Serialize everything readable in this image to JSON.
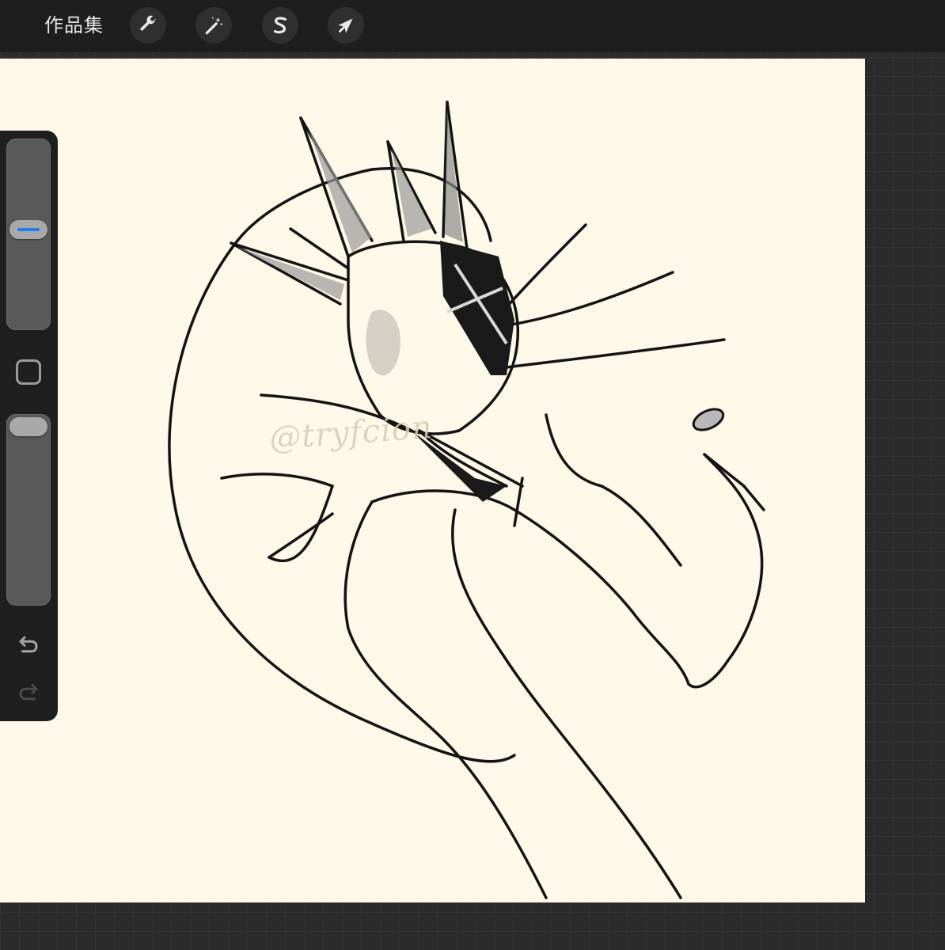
{
  "topbar": {
    "gallery_label": "作品集",
    "tools": [
      {
        "name": "actions",
        "icon": "wrench-icon"
      },
      {
        "name": "adjustments",
        "icon": "magic-wand-icon"
      },
      {
        "name": "selection",
        "icon": "selection-s-icon"
      },
      {
        "name": "transform",
        "icon": "arrow-cursor-icon"
      }
    ]
  },
  "canvas": {
    "watermark": "@tryfcion",
    "background_color": "#fdf8e8"
  },
  "sidebar": {
    "brush_size_level": 0.53,
    "brush_opacity_level": 1.0,
    "accent_color": "#1e7cf5",
    "icons": [
      "modify-square-icon",
      "undo-icon",
      "redo-icon"
    ]
  }
}
